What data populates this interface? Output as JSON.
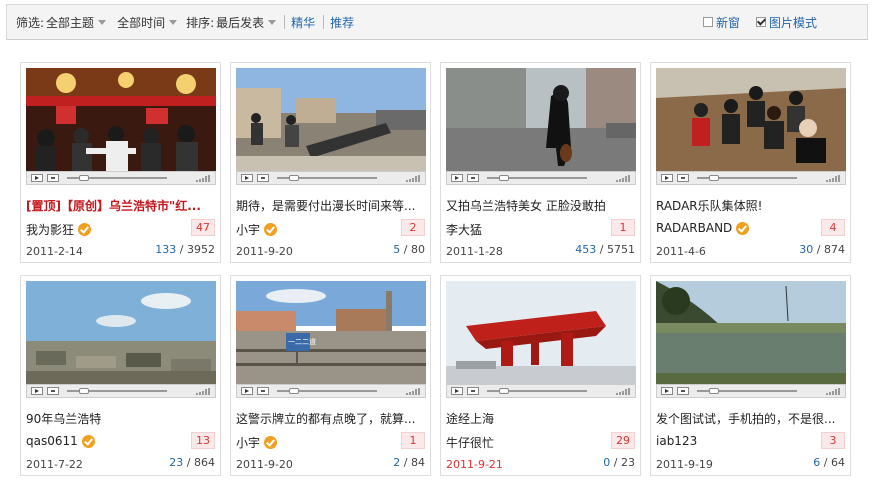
{
  "toolbar": {
    "filter_label": "筛选:",
    "topic_value": "全部主题",
    "time_value": "全部时间",
    "sort_label": "排序:",
    "sort_value": "最后发表",
    "link_featured": "精华",
    "link_recommend": "推荐",
    "new_window_label": "新窗",
    "new_window_checked": false,
    "image_mode_label": "图片模式",
    "image_mode_checked": true
  },
  "cards": [
    {
      "title": "[置顶]【原创】乌兰浩特市\"红...",
      "pinned": true,
      "author": "我为影狂",
      "verified": true,
      "count": "47",
      "date": "2011-2-14",
      "views": "133",
      "total": "3952"
    },
    {
      "title": "期待，是需要付出漫长时间来等...",
      "author": "小宇",
      "verified": true,
      "count": "2",
      "date": "2011-9-20",
      "views": "5",
      "total": "80"
    },
    {
      "title": "又拍乌兰浩特美女 正脸没敢拍",
      "author": "李大猛",
      "verified": false,
      "count": "1",
      "date": "2011-1-28",
      "views": "453",
      "total": "5751"
    },
    {
      "title": "RADAR乐队集体照!",
      "author": "RADARBAND",
      "verified": true,
      "count": "4",
      "date": "2011-4-6",
      "views": "30",
      "total": "874"
    },
    {
      "title": "90年乌兰浩特",
      "author": "qas0611",
      "verified": true,
      "count": "13",
      "date": "2011-7-22",
      "views": "23",
      "total": "864"
    },
    {
      "title": "这警示牌立的都有点晚了，就算...",
      "author": "小宇",
      "verified": true,
      "count": "1",
      "date": "2011-9-20",
      "views": "2",
      "total": "84"
    },
    {
      "title": "途经上海",
      "author": "牛仔很忙",
      "verified": false,
      "count": "29",
      "date": "2011-9-21",
      "date_red": true,
      "views": "0",
      "total": "23"
    },
    {
      "title": "发个图试试，手机拍的，不是很...",
      "author": "iab123",
      "verified": false,
      "count": "3",
      "date": "2011-9-19",
      "views": "6",
      "total": "64"
    }
  ],
  "sign_text": "一二二道"
}
